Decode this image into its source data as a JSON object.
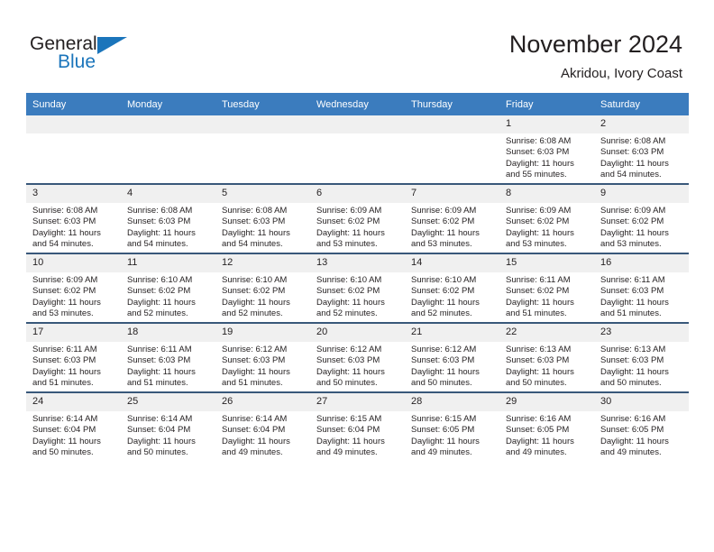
{
  "brand": {
    "name_top": "General",
    "name_bottom": "Blue",
    "triangle_color": "#1b75bb"
  },
  "header": {
    "title": "November 2024",
    "subtitle": "Akridou, Ivory Coast",
    "header_bg": "#3b7cbe",
    "row_divider": "#39587a",
    "daynum_bg": "#f0f0f0"
  },
  "weekday_headers": [
    "Sunday",
    "Monday",
    "Tuesday",
    "Wednesday",
    "Thursday",
    "Friday",
    "Saturday"
  ],
  "weeks": [
    [
      {
        "day": "",
        "empty": true
      },
      {
        "day": "",
        "empty": true
      },
      {
        "day": "",
        "empty": true
      },
      {
        "day": "",
        "empty": true
      },
      {
        "day": "",
        "empty": true
      },
      {
        "day": "1",
        "sunrise": "Sunrise: 6:08 AM",
        "sunset": "Sunset: 6:03 PM",
        "daylight1": "Daylight: 11 hours",
        "daylight2": "and 55 minutes."
      },
      {
        "day": "2",
        "sunrise": "Sunrise: 6:08 AM",
        "sunset": "Sunset: 6:03 PM",
        "daylight1": "Daylight: 11 hours",
        "daylight2": "and 54 minutes."
      }
    ],
    [
      {
        "day": "3",
        "sunrise": "Sunrise: 6:08 AM",
        "sunset": "Sunset: 6:03 PM",
        "daylight1": "Daylight: 11 hours",
        "daylight2": "and 54 minutes."
      },
      {
        "day": "4",
        "sunrise": "Sunrise: 6:08 AM",
        "sunset": "Sunset: 6:03 PM",
        "daylight1": "Daylight: 11 hours",
        "daylight2": "and 54 minutes."
      },
      {
        "day": "5",
        "sunrise": "Sunrise: 6:08 AM",
        "sunset": "Sunset: 6:03 PM",
        "daylight1": "Daylight: 11 hours",
        "daylight2": "and 54 minutes."
      },
      {
        "day": "6",
        "sunrise": "Sunrise: 6:09 AM",
        "sunset": "Sunset: 6:02 PM",
        "daylight1": "Daylight: 11 hours",
        "daylight2": "and 53 minutes."
      },
      {
        "day": "7",
        "sunrise": "Sunrise: 6:09 AM",
        "sunset": "Sunset: 6:02 PM",
        "daylight1": "Daylight: 11 hours",
        "daylight2": "and 53 minutes."
      },
      {
        "day": "8",
        "sunrise": "Sunrise: 6:09 AM",
        "sunset": "Sunset: 6:02 PM",
        "daylight1": "Daylight: 11 hours",
        "daylight2": "and 53 minutes."
      },
      {
        "day": "9",
        "sunrise": "Sunrise: 6:09 AM",
        "sunset": "Sunset: 6:02 PM",
        "daylight1": "Daylight: 11 hours",
        "daylight2": "and 53 minutes."
      }
    ],
    [
      {
        "day": "10",
        "sunrise": "Sunrise: 6:09 AM",
        "sunset": "Sunset: 6:02 PM",
        "daylight1": "Daylight: 11 hours",
        "daylight2": "and 53 minutes."
      },
      {
        "day": "11",
        "sunrise": "Sunrise: 6:10 AM",
        "sunset": "Sunset: 6:02 PM",
        "daylight1": "Daylight: 11 hours",
        "daylight2": "and 52 minutes."
      },
      {
        "day": "12",
        "sunrise": "Sunrise: 6:10 AM",
        "sunset": "Sunset: 6:02 PM",
        "daylight1": "Daylight: 11 hours",
        "daylight2": "and 52 minutes."
      },
      {
        "day": "13",
        "sunrise": "Sunrise: 6:10 AM",
        "sunset": "Sunset: 6:02 PM",
        "daylight1": "Daylight: 11 hours",
        "daylight2": "and 52 minutes."
      },
      {
        "day": "14",
        "sunrise": "Sunrise: 6:10 AM",
        "sunset": "Sunset: 6:02 PM",
        "daylight1": "Daylight: 11 hours",
        "daylight2": "and 52 minutes."
      },
      {
        "day": "15",
        "sunrise": "Sunrise: 6:11 AM",
        "sunset": "Sunset: 6:02 PM",
        "daylight1": "Daylight: 11 hours",
        "daylight2": "and 51 minutes."
      },
      {
        "day": "16",
        "sunrise": "Sunrise: 6:11 AM",
        "sunset": "Sunset: 6:03 PM",
        "daylight1": "Daylight: 11 hours",
        "daylight2": "and 51 minutes."
      }
    ],
    [
      {
        "day": "17",
        "sunrise": "Sunrise: 6:11 AM",
        "sunset": "Sunset: 6:03 PM",
        "daylight1": "Daylight: 11 hours",
        "daylight2": "and 51 minutes."
      },
      {
        "day": "18",
        "sunrise": "Sunrise: 6:11 AM",
        "sunset": "Sunset: 6:03 PM",
        "daylight1": "Daylight: 11 hours",
        "daylight2": "and 51 minutes."
      },
      {
        "day": "19",
        "sunrise": "Sunrise: 6:12 AM",
        "sunset": "Sunset: 6:03 PM",
        "daylight1": "Daylight: 11 hours",
        "daylight2": "and 51 minutes."
      },
      {
        "day": "20",
        "sunrise": "Sunrise: 6:12 AM",
        "sunset": "Sunset: 6:03 PM",
        "daylight1": "Daylight: 11 hours",
        "daylight2": "and 50 minutes."
      },
      {
        "day": "21",
        "sunrise": "Sunrise: 6:12 AM",
        "sunset": "Sunset: 6:03 PM",
        "daylight1": "Daylight: 11 hours",
        "daylight2": "and 50 minutes."
      },
      {
        "day": "22",
        "sunrise": "Sunrise: 6:13 AM",
        "sunset": "Sunset: 6:03 PM",
        "daylight1": "Daylight: 11 hours",
        "daylight2": "and 50 minutes."
      },
      {
        "day": "23",
        "sunrise": "Sunrise: 6:13 AM",
        "sunset": "Sunset: 6:03 PM",
        "daylight1": "Daylight: 11 hours",
        "daylight2": "and 50 minutes."
      }
    ],
    [
      {
        "day": "24",
        "sunrise": "Sunrise: 6:14 AM",
        "sunset": "Sunset: 6:04 PM",
        "daylight1": "Daylight: 11 hours",
        "daylight2": "and 50 minutes."
      },
      {
        "day": "25",
        "sunrise": "Sunrise: 6:14 AM",
        "sunset": "Sunset: 6:04 PM",
        "daylight1": "Daylight: 11 hours",
        "daylight2": "and 50 minutes."
      },
      {
        "day": "26",
        "sunrise": "Sunrise: 6:14 AM",
        "sunset": "Sunset: 6:04 PM",
        "daylight1": "Daylight: 11 hours",
        "daylight2": "and 49 minutes."
      },
      {
        "day": "27",
        "sunrise": "Sunrise: 6:15 AM",
        "sunset": "Sunset: 6:04 PM",
        "daylight1": "Daylight: 11 hours",
        "daylight2": "and 49 minutes."
      },
      {
        "day": "28",
        "sunrise": "Sunrise: 6:15 AM",
        "sunset": "Sunset: 6:05 PM",
        "daylight1": "Daylight: 11 hours",
        "daylight2": "and 49 minutes."
      },
      {
        "day": "29",
        "sunrise": "Sunrise: 6:16 AM",
        "sunset": "Sunset: 6:05 PM",
        "daylight1": "Daylight: 11 hours",
        "daylight2": "and 49 minutes."
      },
      {
        "day": "30",
        "sunrise": "Sunrise: 6:16 AM",
        "sunset": "Sunset: 6:05 PM",
        "daylight1": "Daylight: 11 hours",
        "daylight2": "and 49 minutes."
      }
    ]
  ]
}
